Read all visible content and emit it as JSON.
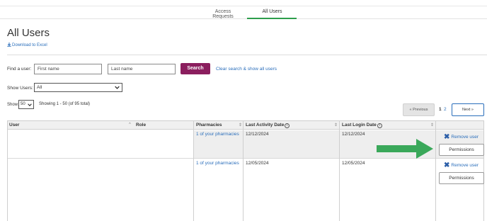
{
  "tabs": [
    {
      "label": "Access Requests",
      "active": false
    },
    {
      "label": "All Users",
      "active": true
    }
  ],
  "page": {
    "title": "All Users",
    "download_label": "Download to Excel"
  },
  "search": {
    "find_label": "Find a user:",
    "first_name_placeholder": "First name",
    "last_name_placeholder": "Last name",
    "search_button": "Search",
    "clear_link": "Clear search & show all users"
  },
  "filters": {
    "show_users_label": "Show Users:",
    "show_users_value": "All",
    "show_label": "Show:",
    "page_size_value": "50",
    "showing_text": "Showing 1 - 50 (of 95 total)"
  },
  "pagination": {
    "previous": "« Previous",
    "pages": [
      "1",
      "2"
    ],
    "current_page": "1",
    "next": "Next »"
  },
  "table": {
    "columns": [
      "User",
      "Role",
      "Pharmacies",
      "Last Activity Date",
      "Last Login Date"
    ],
    "rows": [
      {
        "user": "",
        "role": "",
        "pharmacies": "1 of your pharmacies",
        "last_activity": "12/12/2024",
        "last_login": "12/12/2024",
        "remove_label": "Remove user",
        "permissions_label": "Permissions"
      },
      {
        "user": "",
        "role": "",
        "pharmacies": "1 of your pharmacies",
        "last_activity": "12/05/2024",
        "last_login": "12/05/2024",
        "remove_label": "Remove user",
        "permissions_label": "Permissions"
      }
    ]
  },
  "colors": {
    "accent_green": "#2e9e4c",
    "search_button": "#8b1e5e",
    "link_blue": "#2a6ebb",
    "arrow_green": "#3aa85a"
  },
  "icons": [
    "download-icon",
    "chevron-down-icon",
    "sort-icon",
    "info-icon",
    "remove-x-icon",
    "arrow-right-icon"
  ]
}
